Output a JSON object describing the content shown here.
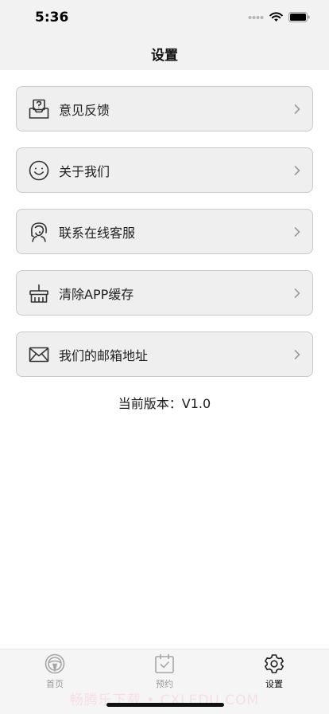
{
  "status_bar": {
    "time": "5:36",
    "icons": [
      "signal-dots-icon",
      "wifi-icon",
      "battery-icon"
    ]
  },
  "nav": {
    "title": "设置"
  },
  "menu": {
    "items": [
      {
        "label": "意见反馈",
        "icon": "feedback-icon"
      },
      {
        "label": "关于我们",
        "icon": "smiley-icon"
      },
      {
        "label": "联系在线客服",
        "icon": "headset-icon"
      },
      {
        "label": "清除APP缓存",
        "icon": "broom-icon"
      },
      {
        "label": "我们的邮箱地址",
        "icon": "mail-icon"
      }
    ]
  },
  "version": {
    "text": "当前版本：V1.0"
  },
  "tab_bar": {
    "tabs": [
      {
        "label": "首页",
        "icon": "steering-wheel-icon",
        "active": false
      },
      {
        "label": "预约",
        "icon": "calendar-check-icon",
        "active": false
      },
      {
        "label": "设置",
        "icon": "gear-icon",
        "active": true
      }
    ]
  },
  "watermark": {
    "text": "畅腾乐下载 • CXLEDU.COM"
  },
  "colors": {
    "header_bg": "#f2f2f2",
    "item_bg": "#efefef",
    "item_border": "#c9c9c9",
    "tab_inactive": "#9a9a9a",
    "tab_active": "#111111"
  }
}
